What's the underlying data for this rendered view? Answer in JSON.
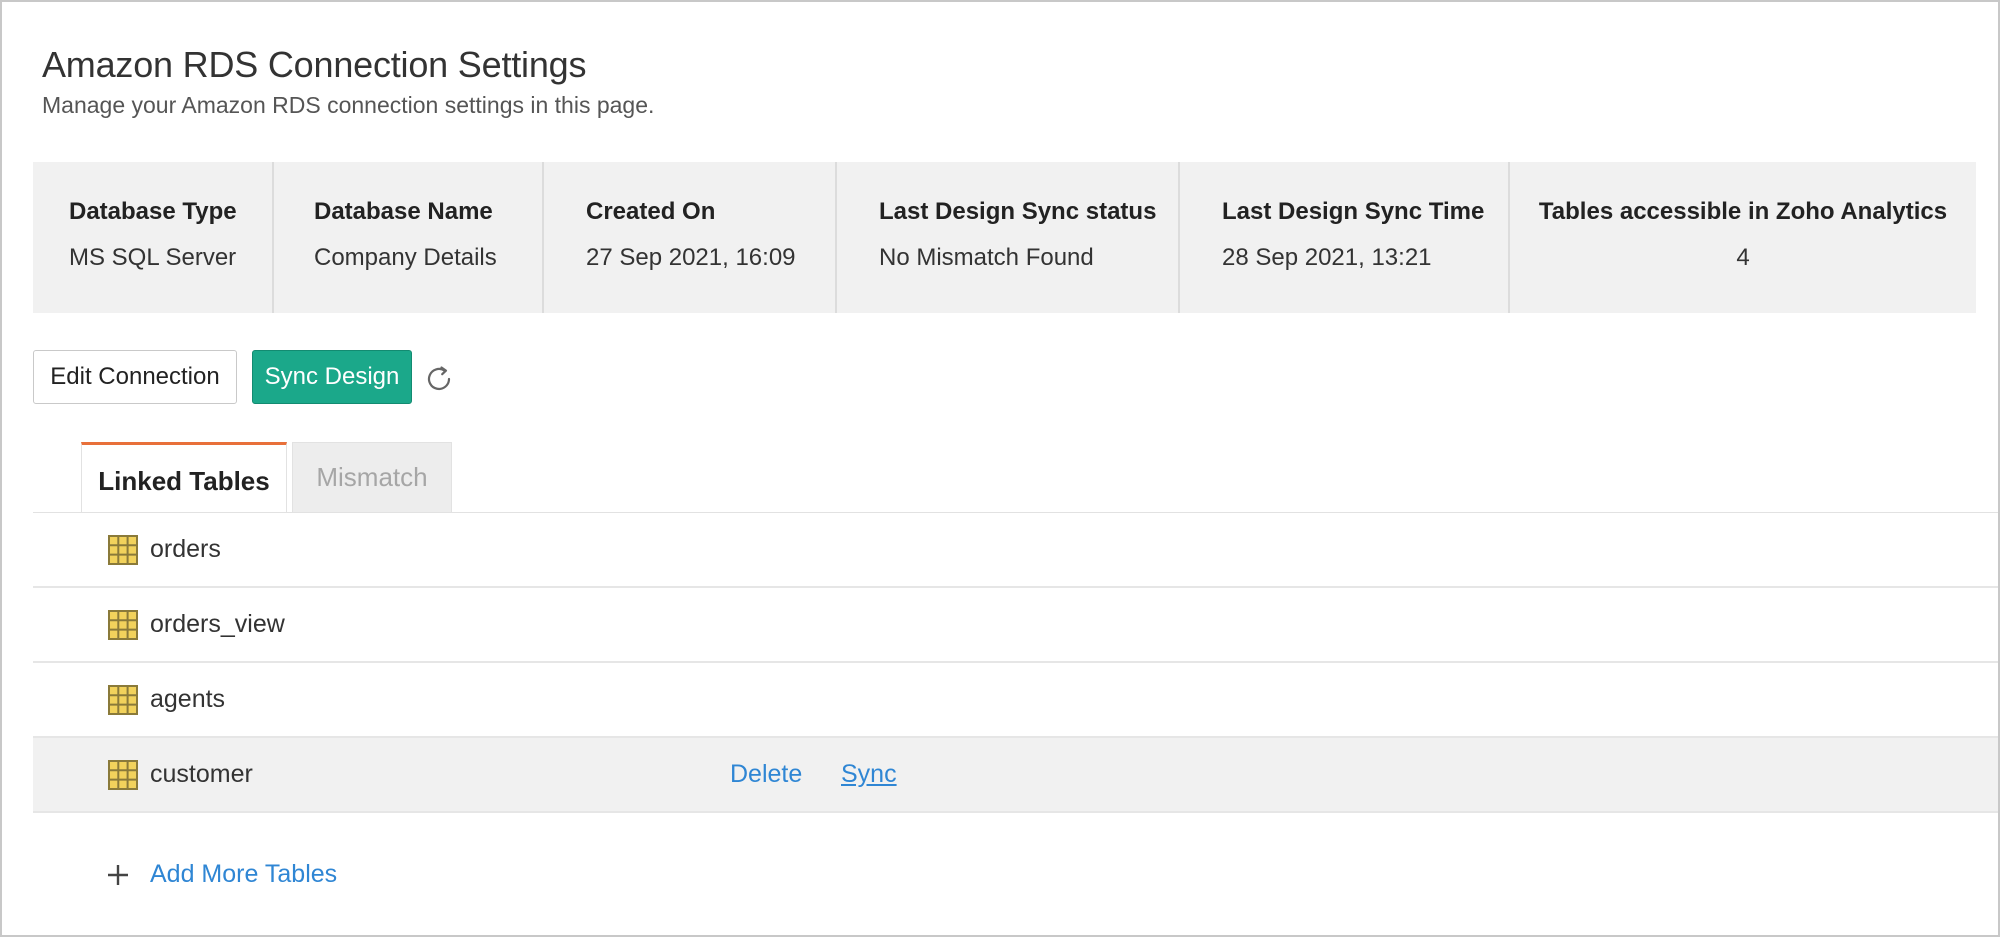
{
  "header": {
    "title": "Amazon RDS Connection Settings",
    "subtitle": "Manage your Amazon RDS connection settings in this page."
  },
  "info": [
    {
      "label": "Database Type",
      "value": "MS SQL Server"
    },
    {
      "label": "Database Name",
      "value": "Company Details"
    },
    {
      "label": "Created On",
      "value": "27 Sep 2021, 16:09"
    },
    {
      "label": "Last Design Sync status",
      "value": "No Mismatch Found"
    },
    {
      "label": "Last Design Sync Time",
      "value": "28 Sep 2021, 13:21"
    },
    {
      "label": "Tables accessible in Zoho Analytics",
      "value": "4"
    }
  ],
  "actions": {
    "edit_label": "Edit Connection",
    "sync_label": "Sync Design",
    "refresh_icon": "refresh-icon"
  },
  "tabs": [
    {
      "label": "Linked Tables",
      "active": true
    },
    {
      "label": "Mismatch",
      "active": false
    }
  ],
  "tables": [
    {
      "name": "orders"
    },
    {
      "name": "orders_view"
    },
    {
      "name": "agents"
    },
    {
      "name": "customer",
      "hovered": true
    }
  ],
  "row_actions": {
    "delete_label": "Delete",
    "sync_label": "Sync"
  },
  "add_more": {
    "label": "Add More Tables",
    "icon": "plus-icon"
  },
  "colors": {
    "accent_green": "#1ba88a",
    "active_tab_border": "#e8703a",
    "link_blue": "#2f86d4",
    "table_icon_fill": "#f2d25c",
    "table_icon_stroke": "#8a7a3a"
  }
}
